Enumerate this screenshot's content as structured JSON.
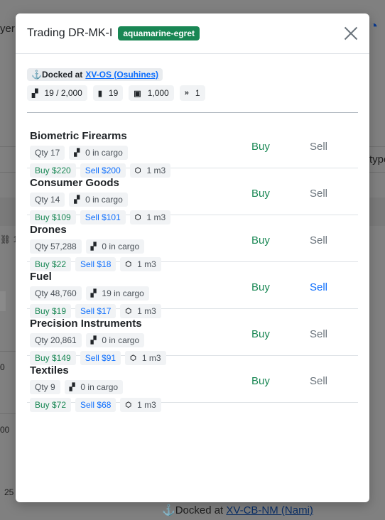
{
  "background": {
    "frag_top_left": "yer",
    "frag_right_mid": "type",
    "frag_row1": "1,",
    "frag_row2": "0",
    "frag_row3": "00",
    "frag_bottom_left": "25",
    "docked_prefix": "Docked at",
    "docked_link": "XV-CB-NM (Nami)"
  },
  "modal": {
    "title": "Trading DR-MK-I",
    "badge": "aquamarine-egret",
    "close_icon": "close-icon",
    "docked_prefix": "Docked at",
    "docked_link": "XV-OS (Osuhines)",
    "stats": {
      "cargo": "19 / 2,000",
      "fuel": "19",
      "credits": "1,000",
      "speed": "1"
    },
    "actions": {
      "buy": "Buy",
      "sell": "Sell"
    },
    "goods": [
      {
        "name": "Biometric Firearms",
        "qty": "Qty 17",
        "cargo": "0 in cargo",
        "buy": "Buy $220",
        "sell": "Sell $200",
        "volume": "1 m3",
        "sell_active": false
      },
      {
        "name": "Consumer Goods",
        "qty": "Qty 14",
        "cargo": "0 in cargo",
        "buy": "Buy $109",
        "sell": "Sell $101",
        "volume": "1 m3",
        "sell_active": false
      },
      {
        "name": "Drones",
        "qty": "Qty 57,288",
        "cargo": "0 in cargo",
        "buy": "Buy $22",
        "sell": "Sell $18",
        "volume": "1 m3",
        "sell_active": false
      },
      {
        "name": "Fuel",
        "qty": "Qty 48,760",
        "cargo": "19 in cargo",
        "buy": "Buy $19",
        "sell": "Sell $17",
        "volume": "1 m3",
        "sell_active": true
      },
      {
        "name": "Precision Instruments",
        "qty": "Qty 20,861",
        "cargo": "0 in cargo",
        "buy": "Buy $149",
        "sell": "Sell $91",
        "volume": "1 m3",
        "sell_active": false
      },
      {
        "name": "Textiles",
        "qty": "Qty 9",
        "cargo": "0 in cargo",
        "buy": "Buy $72",
        "sell": "Sell $68",
        "volume": "1 m3",
        "sell_active": false
      }
    ]
  }
}
